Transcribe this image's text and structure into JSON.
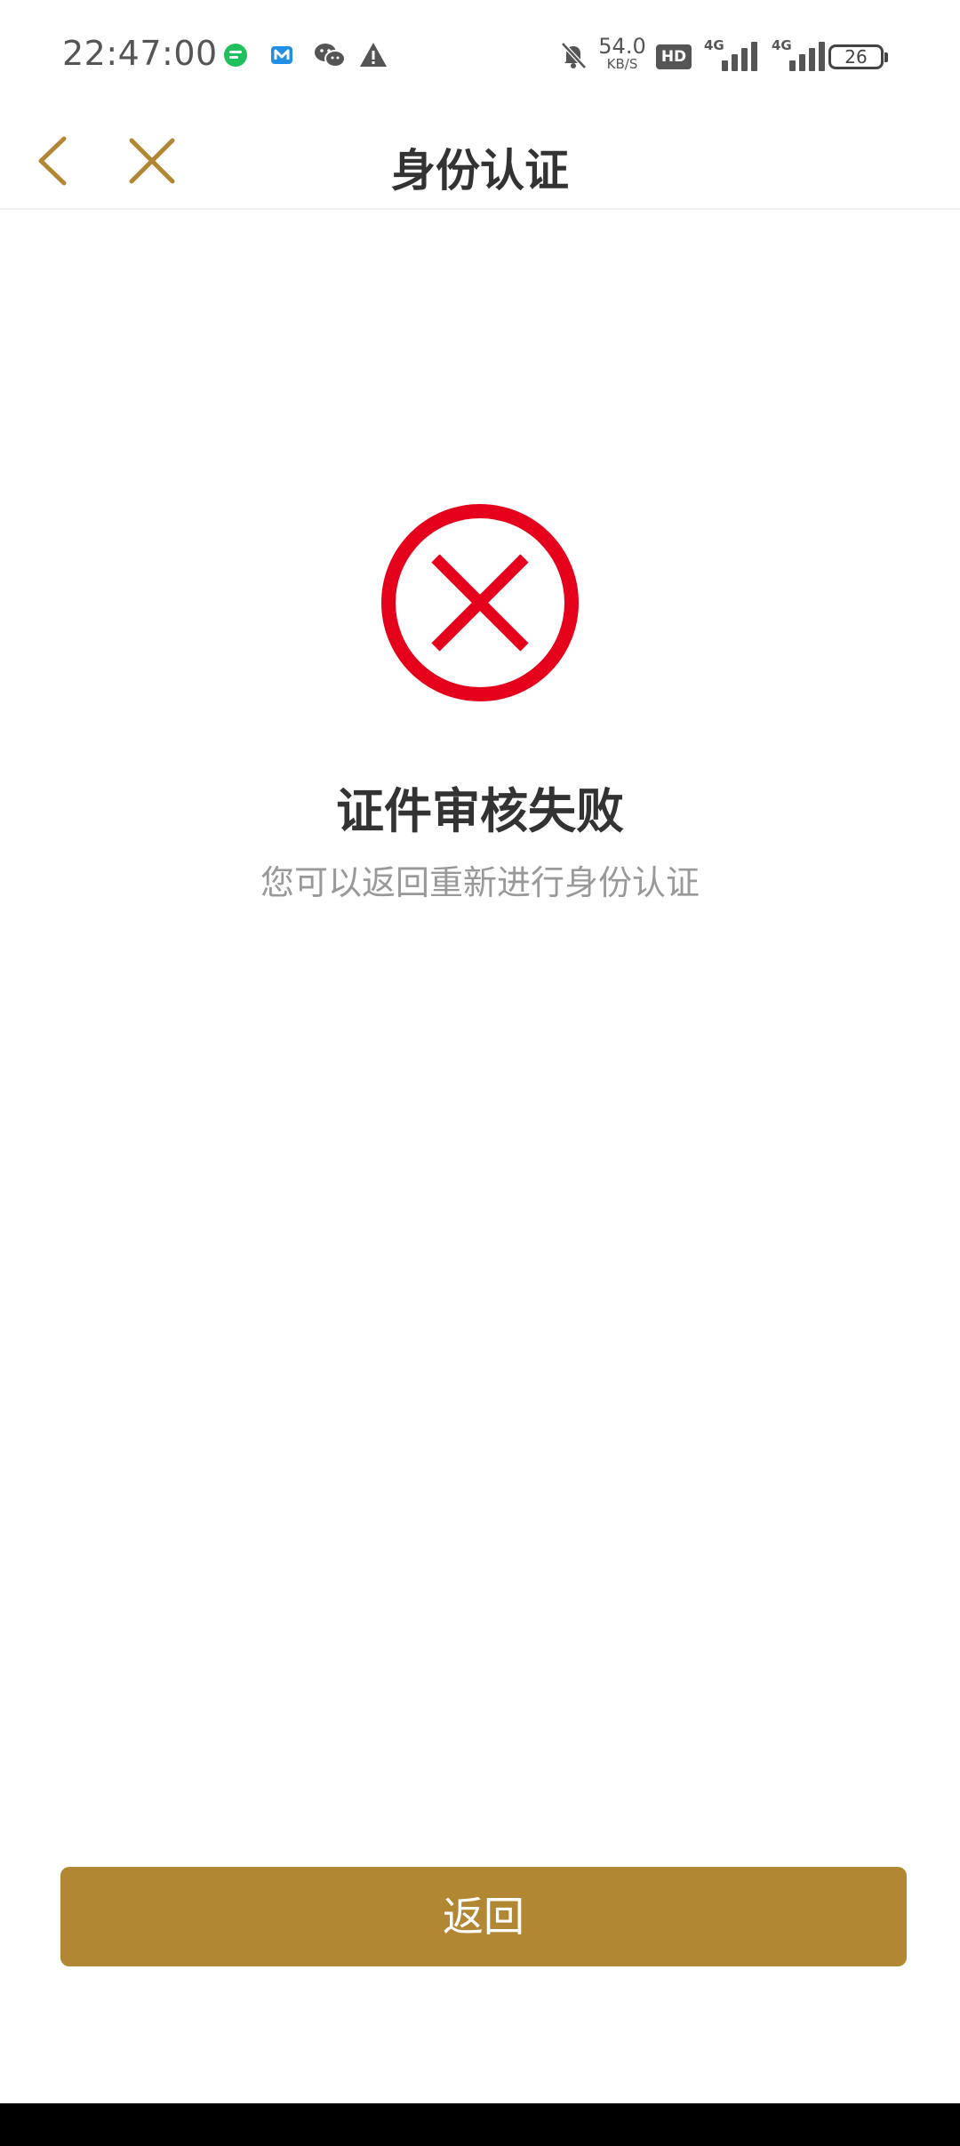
{
  "status_bar": {
    "time": "22:47:00",
    "net_speed_value": "54.0",
    "net_speed_unit": "KB/S",
    "hd_badge": "HD",
    "signal1_tag": "4G",
    "signal2_tag": "4G",
    "battery_level": "26",
    "icons": [
      "message-app-icon",
      "m-app-icon",
      "wechat-icon",
      "warning-icon",
      "bell-muted-icon"
    ]
  },
  "header": {
    "title": "身份认证",
    "back_icon": "chevron-left-icon",
    "close_icon": "close-icon"
  },
  "result": {
    "icon": "error-circle-icon",
    "title": "证件审核失败",
    "subtitle": "您可以返回重新进行身份认证"
  },
  "actions": {
    "return_label": "返回"
  },
  "colors": {
    "accent": "#b28734",
    "error": "#e5001c",
    "title_text": "#333333",
    "muted_text": "#999999"
  }
}
